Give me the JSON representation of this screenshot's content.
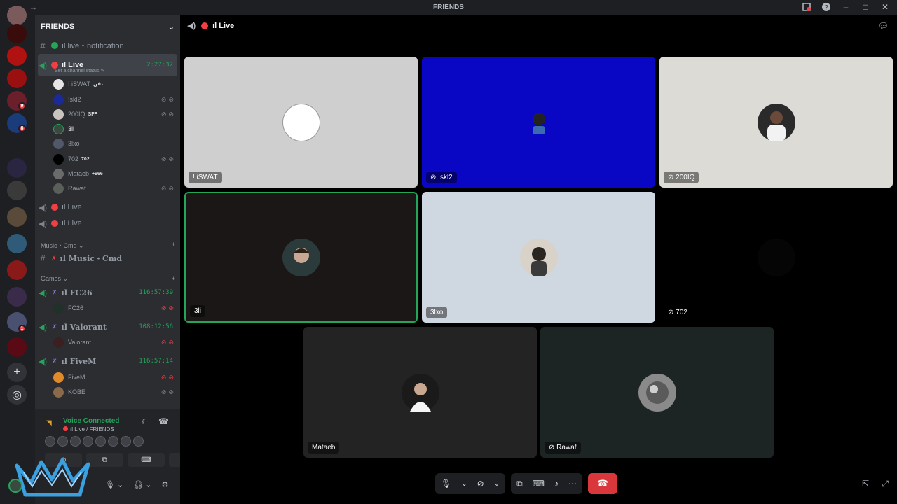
{
  "window": {
    "title": "FRIENDS",
    "nav_back": "←",
    "nav_fwd": "→"
  },
  "titlebar_icons": [
    "inbox-icon",
    "help-icon",
    "minimize-icon",
    "maximize-icon",
    "close-icon"
  ],
  "server_badges": [
    "9",
    "8",
    "1"
  ],
  "sidebar": {
    "header": "FRIENDS",
    "channels": [
      {
        "label": "ıl live・notification"
      },
      {
        "label": "ıl Live",
        "timer": "2:27:32",
        "status": "Set a channel status"
      },
      {
        "label": "ıl Live"
      },
      {
        "label": "ıl Live"
      }
    ],
    "users_live": [
      {
        "name": "! iSWAT",
        "tag": "ﺗﻘﻦ"
      },
      {
        "name": "!skl2",
        "tag": ""
      },
      {
        "name": "200IQ",
        "tag": "SFF"
      },
      {
        "name": "3li",
        "tag": ""
      },
      {
        "name": "3lxo",
        "tag": ""
      },
      {
        "name": "702",
        "tag": "702"
      },
      {
        "name": "Mataeb",
        "tag": "+966"
      },
      {
        "name": "Rawaf",
        "tag": ""
      }
    ],
    "cat_music": "Music・Cmd",
    "music_channel": "ıl Music・Cmd",
    "cat_games": "Games",
    "games": [
      {
        "label": "ıl FC26",
        "timer": "116:57:39",
        "user": "FC26"
      },
      {
        "label": "ıl Valorant",
        "timer": "108:12:56",
        "user": "Valorant"
      },
      {
        "label": "ıl FiveM",
        "timer": "116:57:14",
        "user": "FiveM"
      }
    ],
    "extra_user": "KOBE"
  },
  "voice": {
    "title": "Voice Connected",
    "sub": "ıl Live / FRIENDS"
  },
  "main": {
    "channel": "ıl Live"
  },
  "tiles": [
    {
      "name": "! iSWAT",
      "bg": "#cfcfcf"
    },
    {
      "name": "!skl2",
      "bg": "#0a07c4"
    },
    {
      "name": "200IQ",
      "bg": "#dddbd6"
    },
    {
      "name": "3li",
      "bg": "#1c1717"
    },
    {
      "name": "3lxo",
      "bg": "#cfd8e1"
    },
    {
      "name": "702",
      "bg": "#000000"
    },
    {
      "name": "Mataeb",
      "bg": "#232323"
    },
    {
      "name": "Rawaf",
      "bg": "#1d2424"
    }
  ],
  "colors": {
    "accent_green": "#23a55a",
    "live_red": "#f23f43",
    "hangup": "#da373c"
  }
}
